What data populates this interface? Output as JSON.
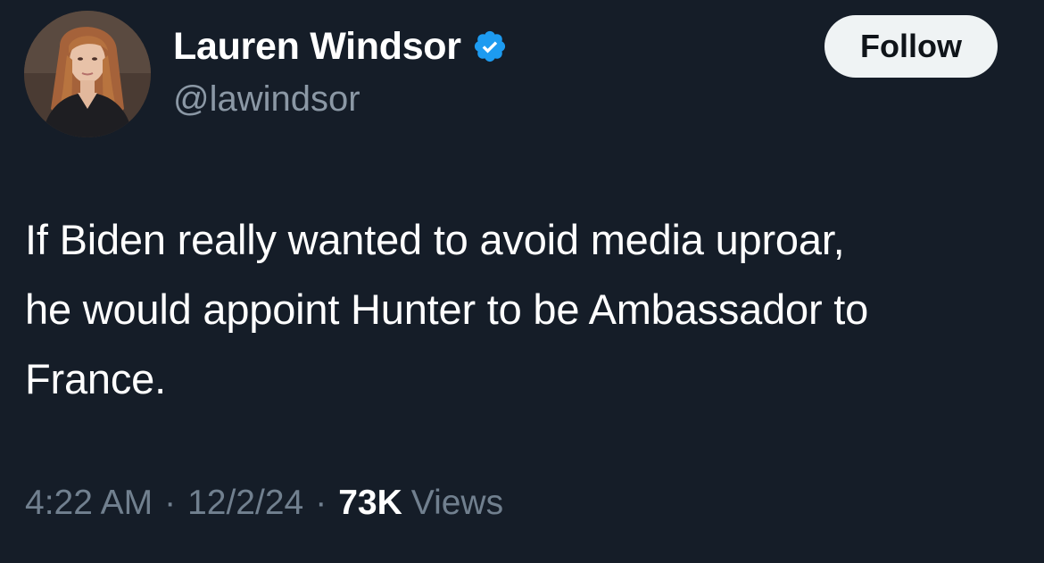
{
  "author": {
    "display_name": "Lauren Windsor",
    "handle": "@lawindsor",
    "verified_icon": "verified-badge-icon",
    "verified_color": "#1d9bf0"
  },
  "follow_button": {
    "label": "Follow"
  },
  "tweet": {
    "lines": [
      "If Biden really wanted to avoid media uproar,",
      "he would appoint Hunter to be Ambassador to",
      "France."
    ]
  },
  "meta": {
    "time": "4:22 AM",
    "separator": "·",
    "date": "12/2/24",
    "views_count": "73K",
    "views_label": "Views"
  },
  "colors": {
    "background": "#151d28",
    "secondary_text": "#8b98a5",
    "button_bg": "#eff3f4"
  }
}
